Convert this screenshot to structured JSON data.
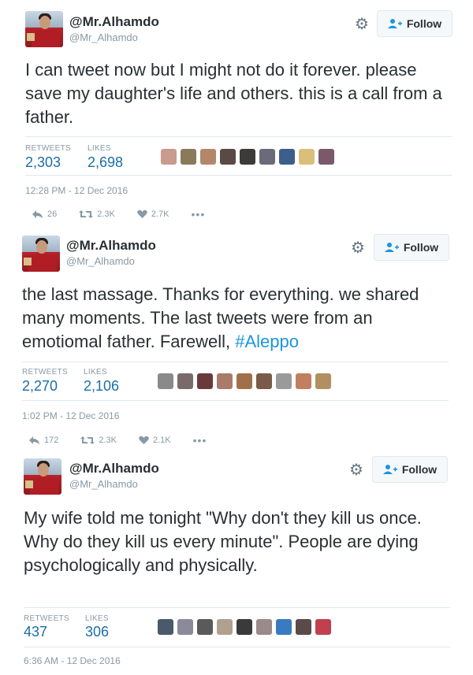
{
  "tweets": [
    {
      "display_name": "@Mr.Alhamdo",
      "handle": "@Mr_Alhamdo",
      "follow_label": "Follow",
      "text_parts": [
        "I can tweet now but I might not do it forever. please save my daughter's life and others. this is a call from a father.",
        ""
      ],
      "hashtag": "",
      "retweets_label": "RETWEETS",
      "retweets": "2,303",
      "likes_label": "LIKES",
      "likes": "2,698",
      "timestamp": "12:28 PM - 12 Dec 2016",
      "reply_count": "26",
      "retweet_count": "2.3K",
      "like_count": "2.7K",
      "liker_colors": [
        "#c99a8e",
        "#8a7a5a",
        "#b5876a",
        "#5a4a44",
        "#3d3a3a",
        "#6a6a7a",
        "#3b5f8a",
        "#d9c07a",
        "#7a5a6a"
      ]
    },
    {
      "display_name": "@Mr.Alhamdo",
      "handle": "@Mr_Alhamdo",
      "follow_label": "Follow",
      "text_parts": [
        "the last massage. Thanks for everything.  we shared many moments. The last tweets were from an emotiomal father. Farewell, ",
        ""
      ],
      "hashtag": "#Aleppo",
      "retweets_label": "RETWEETS",
      "retweets": "2,270",
      "likes_label": "LIKES",
      "likes": "2,106",
      "timestamp": "1:02 PM - 12 Dec 2016",
      "reply_count": "172",
      "retweet_count": "2.3K",
      "like_count": "2.1K",
      "liker_colors": [
        "#8a8a8a",
        "#7a6a6a",
        "#6a3a3a",
        "#aa7a6a",
        "#a0704a",
        "#7a5a4a",
        "#9a9a9a",
        "#c08060",
        "#b09060"
      ]
    },
    {
      "display_name": "@Mr.Alhamdo",
      "handle": "@Mr_Alhamdo",
      "follow_label": "Follow",
      "text_parts": [
        "My wife told me tonight \"Why don't they kill us once. Why do they kill us every minute\". People are dying psychologically and physically.",
        ""
      ],
      "hashtag": "",
      "retweets_label": "RETWEETS",
      "retweets": "437",
      "likes_label": "LIKES",
      "likes": "306",
      "timestamp": "6:36 AM - 12 Dec 2016",
      "reply_count": "",
      "retweet_count": "",
      "like_count": "",
      "liker_colors": [
        "#4a5a6a",
        "#8a8a9a",
        "#5a5a5a",
        "#b0a090",
        "#3a3a3a",
        "#9a8a8a",
        "#3a7ac0",
        "#5a4a4a",
        "#c04050"
      ]
    }
  ],
  "colors": {
    "accent": "#1b95e0",
    "stat_blue": "#1b6ea8",
    "muted": "#8899a6"
  },
  "icons": [
    "gear-icon",
    "follow-person-icon",
    "reply-icon",
    "retweet-icon",
    "heart-icon",
    "more-icon"
  ]
}
